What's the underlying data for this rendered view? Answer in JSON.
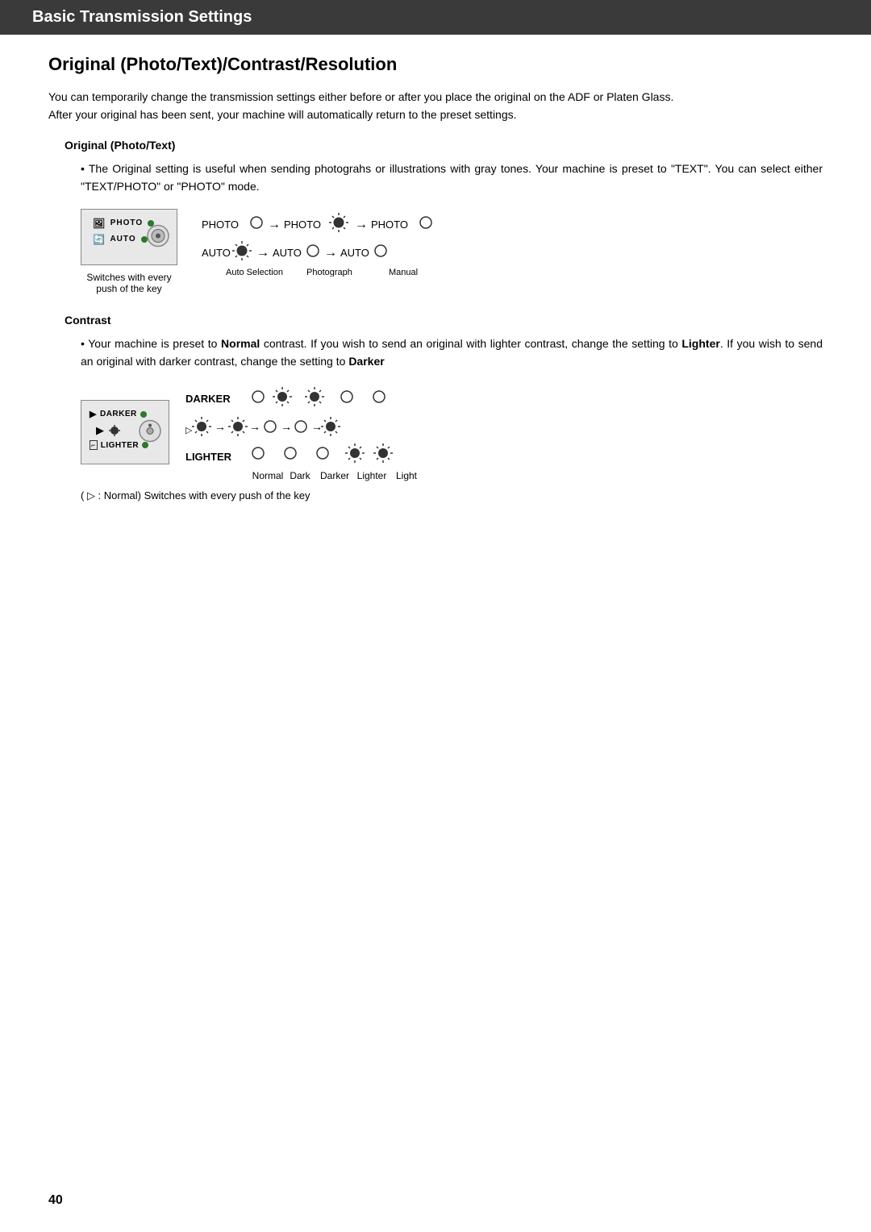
{
  "header": {
    "title": "Basic Transmission Settings"
  },
  "section": {
    "title": "Original (Photo/Text)/Contrast/Resolution",
    "intro": [
      "You can temporarily change the transmission settings either before or after you place the original on the ADF or Platen Glass.",
      "After your original has been sent, your machine will automatically return to the preset settings."
    ],
    "subsections": [
      {
        "name": "Original (Photo/Text)",
        "bullet": "The Original setting is useful when sending photograhs or illustrations with gray tones. Your machine is preset to \"TEXT\". You can select either \"TEXT/PHOTO\" or \"PHOTO\" mode.",
        "panel_labels": [
          "PHOTO",
          "AUTO"
        ],
        "switches_caption": "Switches with every push of the key",
        "flow_labels": [
          "Auto Selection",
          "Photograph",
          "Manual"
        ]
      },
      {
        "name": "Contrast",
        "bullet_parts": {
          "before_normal": "Your machine is preset to ",
          "normal": "Normal",
          "after_normal": " contrast. If you wish to send an original with lighter contrast, change the setting to ",
          "lighter": "Lighter",
          "after_lighter": ". If you wish to send an original with darker contrast, change the setting to ",
          "darker": "Darker"
        },
        "panel_labels": [
          "DARKER",
          "LIGHTER"
        ],
        "flow_labels": [
          "Normal",
          "Dark",
          "Darker",
          "Lighter",
          "Light"
        ],
        "note": "( ▷ : Normal)   Switches with every push of the key"
      }
    ]
  },
  "page_number": "40"
}
